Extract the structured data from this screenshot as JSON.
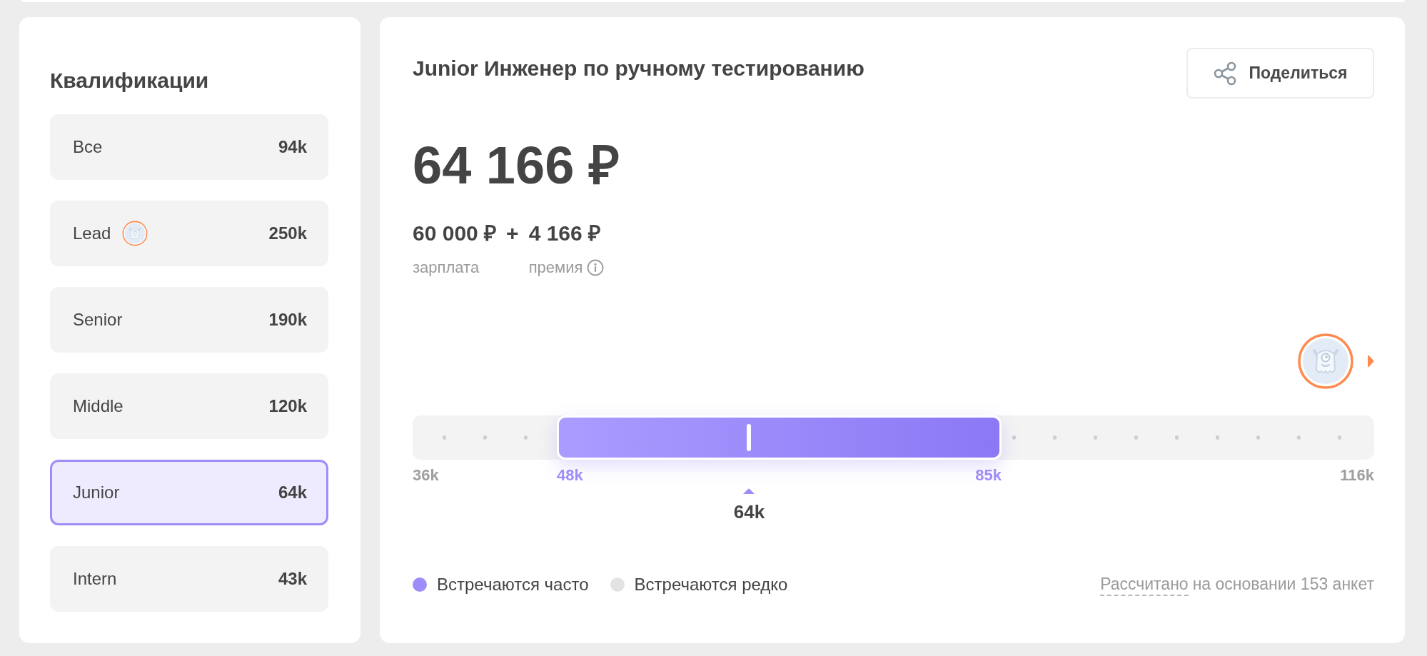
{
  "qualifications": {
    "title": "Квалификации",
    "items": [
      {
        "label": "Все",
        "value": "94k",
        "avatar": false,
        "selected": false
      },
      {
        "label": "Lead",
        "value": "250k",
        "avatar": true,
        "selected": false
      },
      {
        "label": "Senior",
        "value": "190k",
        "avatar": false,
        "selected": false
      },
      {
        "label": "Middle",
        "value": "120k",
        "avatar": false,
        "selected": false
      },
      {
        "label": "Junior",
        "value": "64k",
        "avatar": false,
        "selected": true
      },
      {
        "label": "Intern",
        "value": "43k",
        "avatar": false,
        "selected": false
      }
    ]
  },
  "position": {
    "title": "Junior Инженер по ручному тестированию",
    "share_button": "Поделиться",
    "total": "64 166 ₽",
    "salary": {
      "amount": "60 000 ₽",
      "label": "зарплата"
    },
    "plus": "+",
    "bonus": {
      "amount": "4 166 ₽",
      "label": "премия",
      "info": true
    }
  },
  "range": {
    "avatar": true,
    "min_label": "36k",
    "max_label": "116k",
    "start": {
      "label": "48k"
    },
    "end": {
      "label": "85k"
    },
    "marker": {
      "level": 0.35,
      "label": "64k"
    }
  },
  "legend": [
    {
      "label": "Встречаются часто",
      "color": "#a08cf8"
    },
    {
      "label": "Встречаются редко",
      "color": "#e3e3e3"
    }
  ],
  "footnote": {
    "link": "Рассчитано",
    "text": "на основании 153 анкет"
  }
}
